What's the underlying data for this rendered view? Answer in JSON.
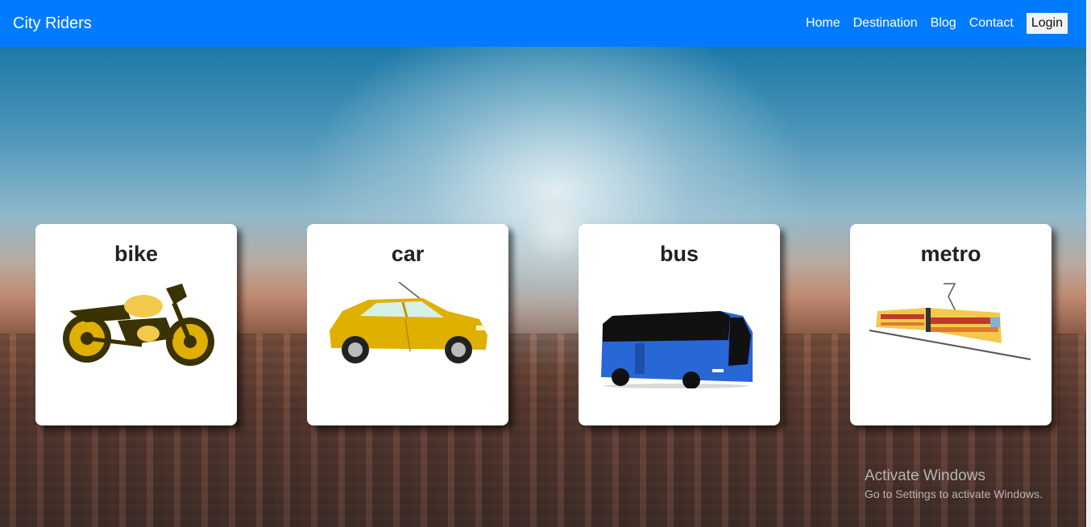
{
  "navbar": {
    "brand": "City Riders",
    "links": [
      "Home",
      "Destination",
      "Blog",
      "Contact"
    ],
    "login_label": "Login",
    "color": "#007bff"
  },
  "cards": [
    {
      "title": "bike",
      "icon": "motorcycle-icon"
    },
    {
      "title": "car",
      "icon": "car-icon"
    },
    {
      "title": "bus",
      "icon": "bus-icon"
    },
    {
      "title": "metro",
      "icon": "tram-icon"
    }
  ],
  "watermark": {
    "title": "Activate Windows",
    "subtitle": "Go to Settings to activate Windows."
  }
}
